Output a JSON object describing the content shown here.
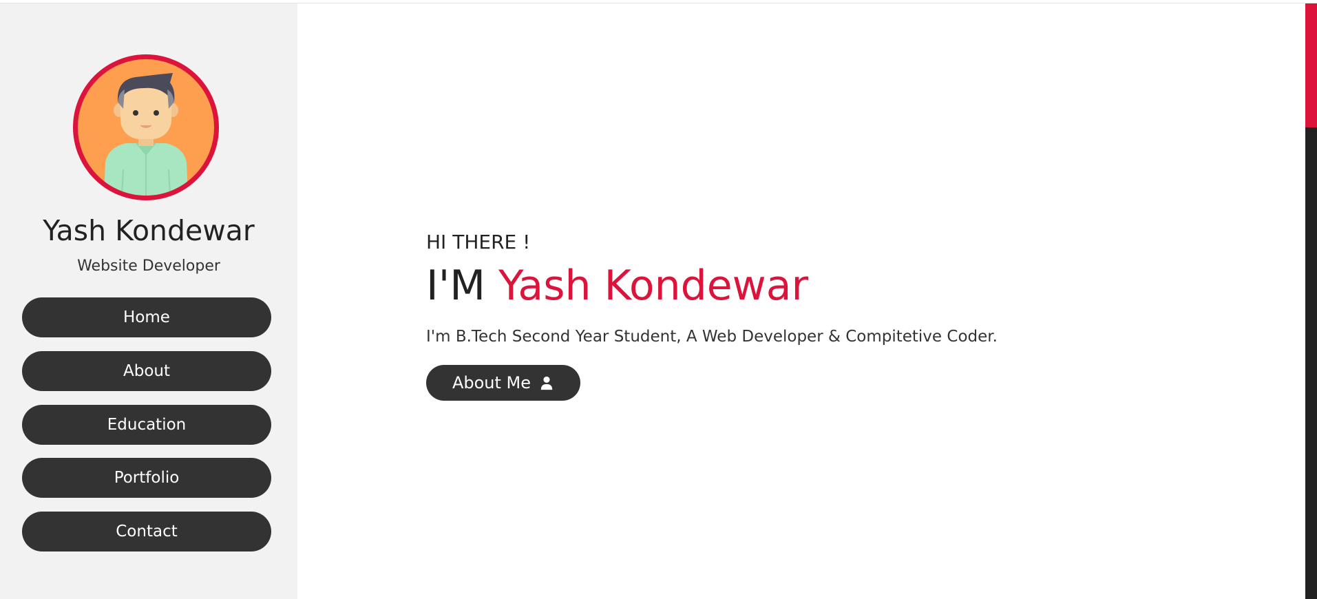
{
  "profile": {
    "name": "Yash Kondewar",
    "role": "Website Developer",
    "avatar_icon": "developer-avatar"
  },
  "nav": {
    "items": [
      {
        "label": "Home"
      },
      {
        "label": "About"
      },
      {
        "label": "Education"
      },
      {
        "label": "Portfolio"
      },
      {
        "label": "Contact"
      }
    ]
  },
  "hero": {
    "greeting": "HI THERE !",
    "prefix": "I'M",
    "name": "Yash Kondewar",
    "description": "I'm B.Tech Second Year Student, A Web Developer & Compitetive Coder.",
    "cta_label": "About Me",
    "cta_icon": "user-icon"
  },
  "colors": {
    "accent": "#dc143c",
    "dark": "#333333",
    "sidebar_bg": "#f2f2f2",
    "avatar_bg": "#fe9f4f"
  }
}
